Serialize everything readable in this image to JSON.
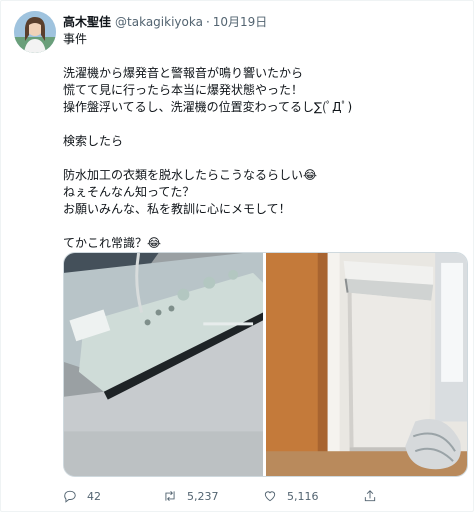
{
  "tweet": {
    "author_name": "高木聖佳",
    "handle": "@takagikiyoka",
    "separator": "·",
    "date": "10月19日",
    "lines": [
      "事件",
      "",
      "洗濯機から爆発音と警報音が鳴り響いたから",
      "慌てて見に行ったら本当に爆発状態やった！",
      "操作盤浮いてるし、洗濯機の位置変わってるし∑(ﾟДﾟ)",
      "",
      "検索したら",
      "",
      "防水加工の衣類を脱水したらこうなるらしい😂",
      "ねぇそんなん知ってた？",
      "お願いみんな、私を教訓に心にメモして！",
      "",
      "てかこれ常識？😂"
    ]
  },
  "actions": {
    "reply_count": "42",
    "retweet_count": "5,237",
    "like_count": "5,116"
  },
  "icons": {
    "reply": "reply-icon",
    "retweet": "retweet-icon",
    "like": "heart-icon",
    "share": "share-icon"
  },
  "colors": {
    "text": "#0f1419",
    "secondary": "#536471",
    "border": "#cfd9de"
  }
}
